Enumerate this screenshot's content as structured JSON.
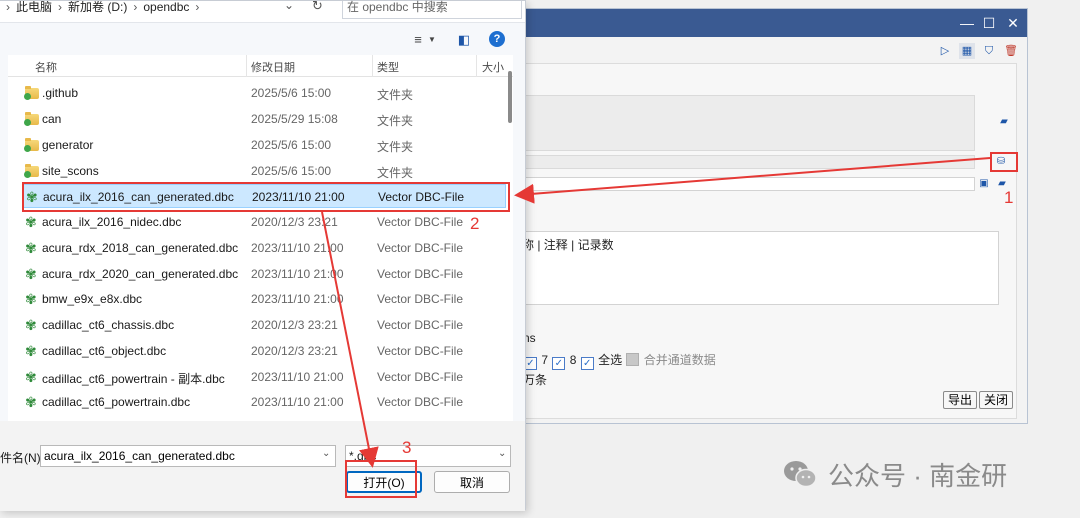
{
  "dialog": {
    "breadcrumb": [
      "此电脑",
      "新加卷 (D:)",
      "opendbc"
    ],
    "search_placeholder": "在 opendbc 中搜索",
    "columns": {
      "name": "名称",
      "date": "修改日期",
      "type": "类型",
      "size": "大小"
    },
    "files": [
      {
        "name": ".github",
        "date": "2025/5/6 15:00",
        "type": "文件夹",
        "kind": "folder"
      },
      {
        "name": "can",
        "date": "2025/5/29 15:08",
        "type": "文件夹",
        "kind": "folder"
      },
      {
        "name": "generator",
        "date": "2025/5/6 15:00",
        "type": "文件夹",
        "kind": "folder"
      },
      {
        "name": "site_scons",
        "date": "2025/5/6 15:00",
        "type": "文件夹",
        "kind": "folder"
      },
      {
        "name": "acura_ilx_2016_can_generated.dbc",
        "date": "2023/11/10 21:00",
        "type": "Vector DBC-File",
        "kind": "dbc",
        "selected": true
      },
      {
        "name": "acura_ilx_2016_nidec.dbc",
        "date": "2020/12/3 23:21",
        "type": "Vector DBC-File",
        "kind": "dbc"
      },
      {
        "name": "acura_rdx_2018_can_generated.dbc",
        "date": "2023/11/10 21:00",
        "type": "Vector DBC-File",
        "kind": "dbc"
      },
      {
        "name": "acura_rdx_2020_can_generated.dbc",
        "date": "2023/11/10 21:00",
        "type": "Vector DBC-File",
        "kind": "dbc"
      },
      {
        "name": "bmw_e9x_e8x.dbc",
        "date": "2023/11/10 21:00",
        "type": "Vector DBC-File",
        "kind": "dbc"
      },
      {
        "name": "cadillac_ct6_chassis.dbc",
        "date": "2020/12/3 23:21",
        "type": "Vector DBC-File",
        "kind": "dbc"
      },
      {
        "name": "cadillac_ct6_object.dbc",
        "date": "2020/12/3 23:21",
        "type": "Vector DBC-File",
        "kind": "dbc"
      },
      {
        "name": "cadillac_ct6_powertrain - 副本.dbc",
        "date": "2023/11/10 21:00",
        "type": "Vector DBC-File",
        "kind": "dbc"
      },
      {
        "name": "cadillac_ct6_powertrain.dbc",
        "date": "2023/11/10 21:00",
        "type": "Vector DBC-File",
        "kind": "dbc"
      }
    ],
    "filename_label": "件名(N):",
    "filename_value": "acura_ilx_2016_can_generated.dbc",
    "filter_value": "*.dbc",
    "open_label": "打开(O)",
    "cancel_label": "取消"
  },
  "background": {
    "columns_text": "称 | 注释 | 记录数",
    "ns_text": "ns",
    "channels_text": "7",
    "channel8_text": "8",
    "select_all_label": "全选",
    "merge_label": "合并通道数据",
    "wan_text": "万条",
    "export_label": "导出",
    "close_label": "关闭"
  },
  "annotations": {
    "step1": "1",
    "step2": "2",
    "step3": "3"
  },
  "watermark": {
    "text": "公众号 · 南金研"
  },
  "colors": {
    "annotation_red": "#e53935",
    "selected_row": "#cce8ff",
    "titlebar": "#3a5a92"
  }
}
